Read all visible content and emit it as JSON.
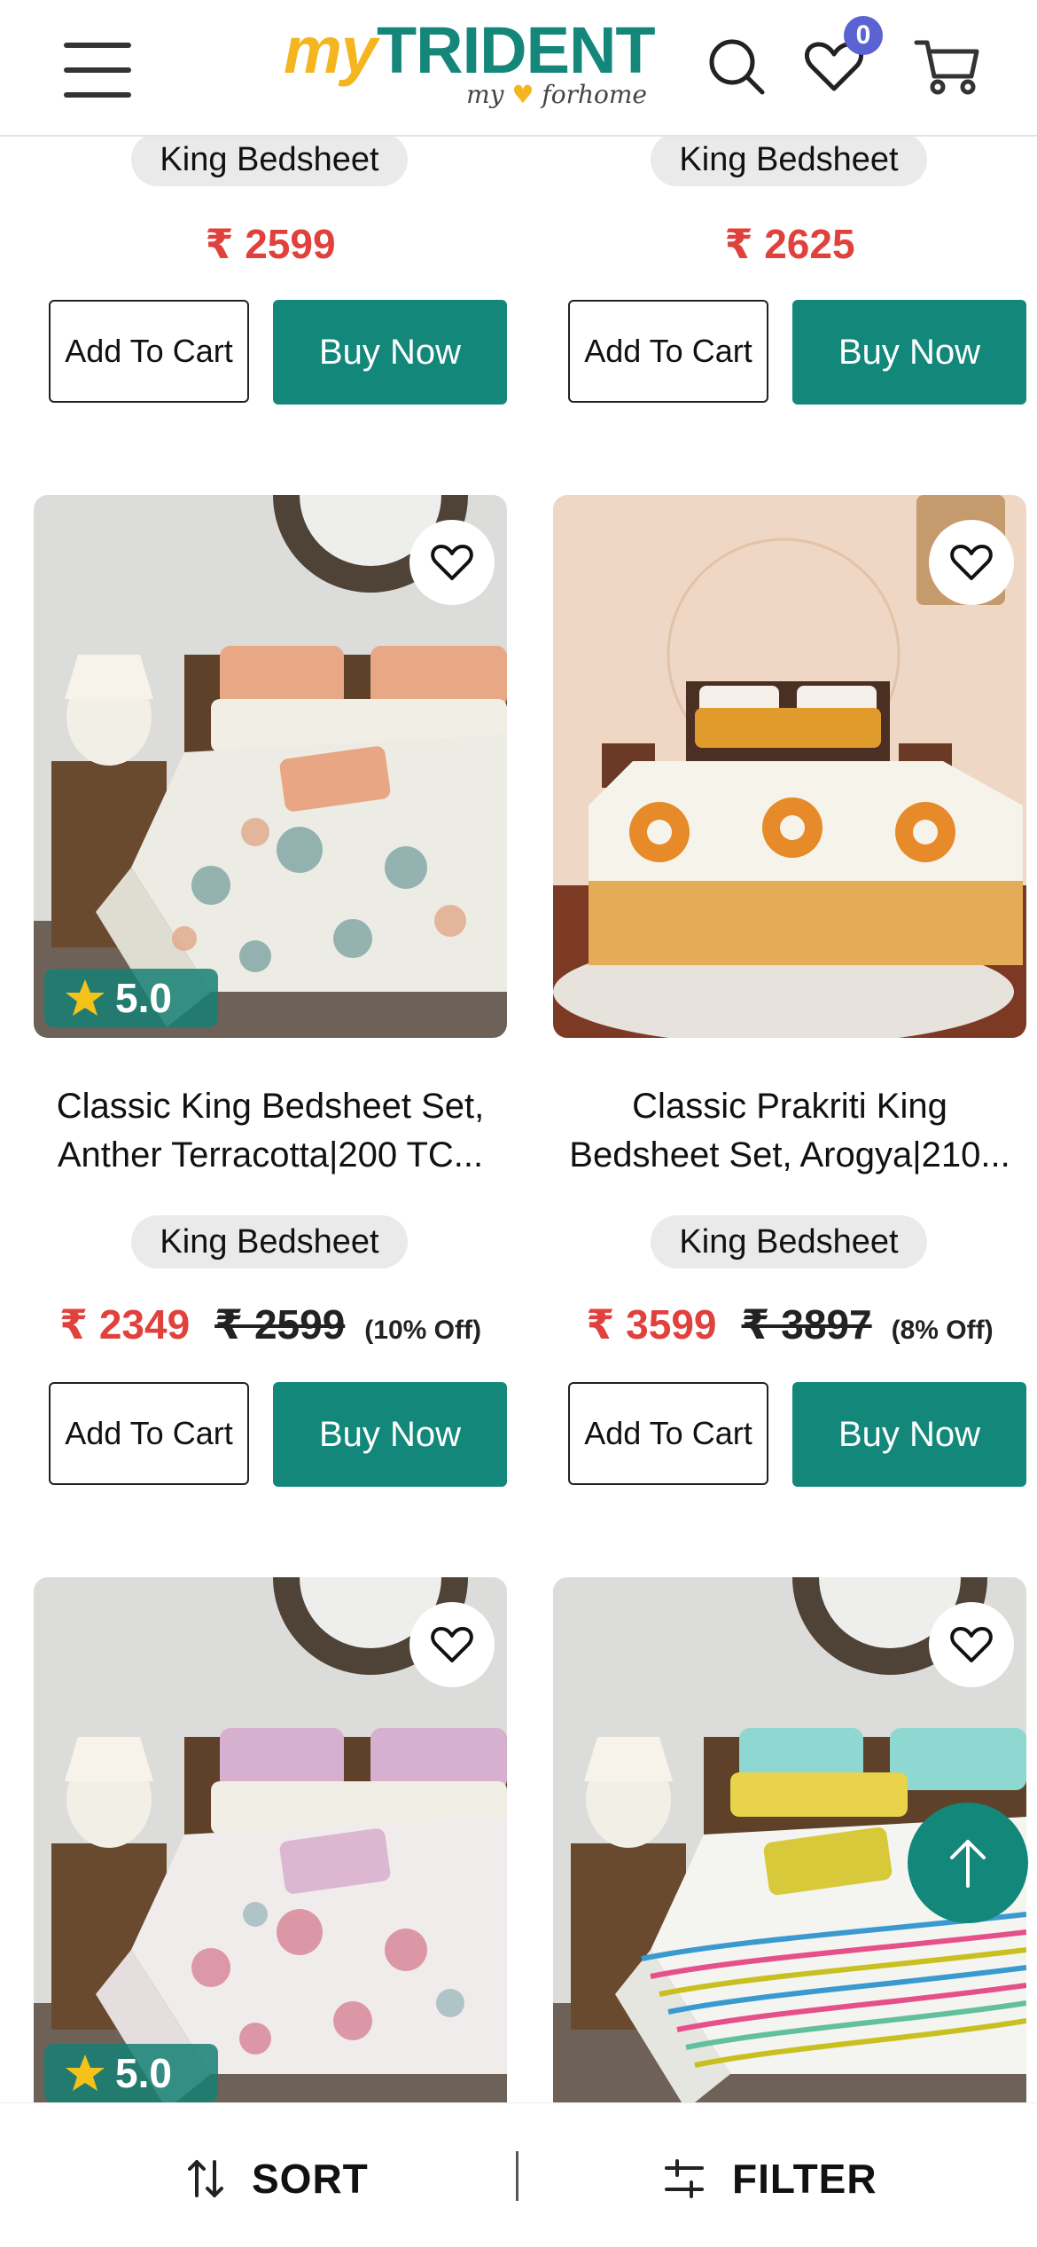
{
  "header": {
    "logo_my": "my",
    "logo_brand": "TRIDENT",
    "logo_tagline_left": "my",
    "logo_tagline_right": "forhome",
    "wishlist_count": "0",
    "icons": [
      "menu-icon",
      "search-icon",
      "heart-icon",
      "cart-icon"
    ]
  },
  "colors": {
    "accent": "#12877a",
    "price": "#e0413c",
    "badge": "#5b63d3",
    "logo_yellow": "#f5b51f"
  },
  "products": [
    {
      "category": "King Bedsheet",
      "price": "₹ 2599",
      "add_to_cart": "Add To Cart",
      "buy_now": "Buy Now"
    },
    {
      "category": "King Bedsheet",
      "price": "₹ 2625",
      "add_to_cart": "Add To Cart",
      "buy_now": "Buy Now"
    },
    {
      "rating": "5.0",
      "title_line1": "Classic King Bedsheet Set,",
      "title_line2": "Anther Terracotta|200 TC...",
      "category": "King Bedsheet",
      "price": "₹ 2349",
      "old_price": "₹ 2599",
      "discount": "(10% Off)",
      "add_to_cart": "Add To Cart",
      "buy_now": "Buy Now"
    },
    {
      "title_line1": "Classic Prakriti King",
      "title_line2": "Bedsheet Set, Arogya|210...",
      "category": "King Bedsheet",
      "price": "₹ 3599",
      "old_price": "₹ 3897",
      "discount": "(8% Off)",
      "add_to_cart": "Add To Cart",
      "buy_now": "Buy Now"
    },
    {
      "rating": "5.0"
    },
    {}
  ],
  "bottom_bar": {
    "sort_label": "SORT",
    "filter_label": "FILTER"
  }
}
